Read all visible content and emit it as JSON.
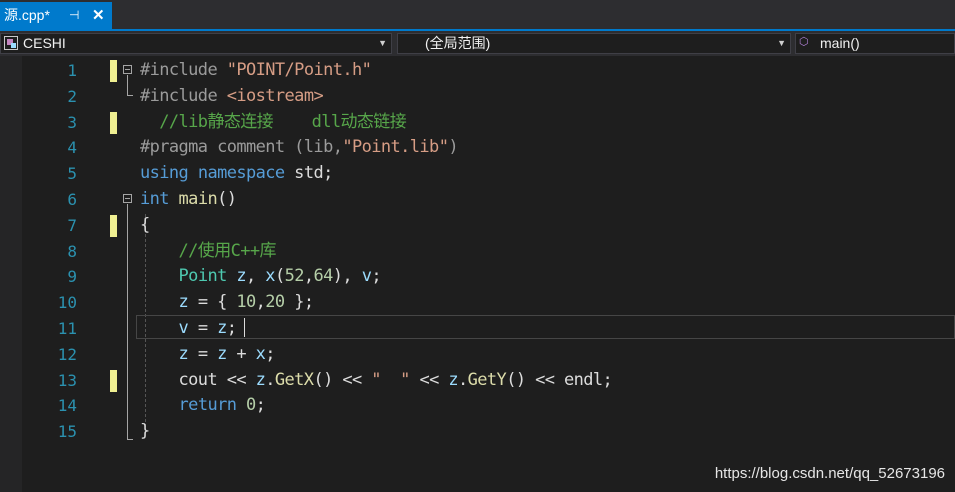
{
  "tab": {
    "label": "源.cpp*",
    "pin_glyph": "⊣",
    "close_glyph": "✕"
  },
  "navbar": {
    "project": "CESHI",
    "scope": "(全局范围)",
    "member": "main()",
    "project_icon": "project-icon",
    "member_icon": "cube-icon"
  },
  "editor": {
    "line_numbers": [
      "1",
      "2",
      "3",
      "4",
      "5",
      "6",
      "7",
      "8",
      "9",
      "10",
      "11",
      "12",
      "13",
      "14",
      "15"
    ],
    "lines": [
      [
        {
          "t": "#include",
          "c": "pp"
        },
        {
          "t": " ",
          "c": "plain"
        },
        {
          "t": "\"POINT/Point.h\"",
          "c": "str"
        }
      ],
      [
        {
          "t": "#include",
          "c": "pp"
        },
        {
          "t": " ",
          "c": "plain"
        },
        {
          "t": "<iostream>",
          "c": "str"
        }
      ],
      [
        {
          "t": "  //lib静态连接    dll动态链接",
          "c": "cm"
        }
      ],
      [
        {
          "t": "#pragma",
          "c": "pp"
        },
        {
          "t": " comment (lib,",
          "c": "pp"
        },
        {
          "t": "\"Point.lib\"",
          "c": "str"
        },
        {
          "t": ")",
          "c": "pp"
        }
      ],
      [
        {
          "t": "using",
          "c": "kw"
        },
        {
          "t": " ",
          "c": "plain"
        },
        {
          "t": "namespace",
          "c": "kw"
        },
        {
          "t": " std;",
          "c": "plain"
        }
      ],
      [
        {
          "t": "int",
          "c": "kw"
        },
        {
          "t": " ",
          "c": "plain"
        },
        {
          "t": "main",
          "c": "fn"
        },
        {
          "t": "()",
          "c": "plain"
        }
      ],
      [
        {
          "t": "{",
          "c": "plain"
        }
      ],
      [
        {
          "t": "    //使用C++库",
          "c": "cm"
        }
      ],
      [
        {
          "t": "    ",
          "c": "plain"
        },
        {
          "t": "Point",
          "c": "typ"
        },
        {
          "t": " ",
          "c": "plain"
        },
        {
          "t": "z",
          "c": "var"
        },
        {
          "t": ", ",
          "c": "plain"
        },
        {
          "t": "x",
          "c": "var"
        },
        {
          "t": "(",
          "c": "plain"
        },
        {
          "t": "52",
          "c": "num"
        },
        {
          "t": ",",
          "c": "plain"
        },
        {
          "t": "64",
          "c": "num"
        },
        {
          "t": "), ",
          "c": "plain"
        },
        {
          "t": "v",
          "c": "var"
        },
        {
          "t": ";",
          "c": "plain"
        }
      ],
      [
        {
          "t": "    ",
          "c": "plain"
        },
        {
          "t": "z",
          "c": "var"
        },
        {
          "t": " = { ",
          "c": "plain"
        },
        {
          "t": "10",
          "c": "num"
        },
        {
          "t": ",",
          "c": "plain"
        },
        {
          "t": "20",
          "c": "num"
        },
        {
          "t": " };",
          "c": "plain"
        }
      ],
      [
        {
          "t": "    ",
          "c": "plain"
        },
        {
          "t": "v",
          "c": "var"
        },
        {
          "t": " = ",
          "c": "plain"
        },
        {
          "t": "z",
          "c": "var"
        },
        {
          "t": ";",
          "c": "plain"
        }
      ],
      [
        {
          "t": "    ",
          "c": "plain"
        },
        {
          "t": "z",
          "c": "var"
        },
        {
          "t": " = ",
          "c": "plain"
        },
        {
          "t": "z",
          "c": "var"
        },
        {
          "t": " + ",
          "c": "plain"
        },
        {
          "t": "x",
          "c": "var"
        },
        {
          "t": ";",
          "c": "plain"
        }
      ],
      [
        {
          "t": "    cout << ",
          "c": "plain"
        },
        {
          "t": "z",
          "c": "var"
        },
        {
          "t": ".",
          "c": "plain"
        },
        {
          "t": "GetX",
          "c": "fn"
        },
        {
          "t": "() << ",
          "c": "plain"
        },
        {
          "t": "\"  \"",
          "c": "str"
        },
        {
          "t": " << ",
          "c": "plain"
        },
        {
          "t": "z",
          "c": "var"
        },
        {
          "t": ".",
          "c": "plain"
        },
        {
          "t": "GetY",
          "c": "fn"
        },
        {
          "t": "() << endl;",
          "c": "plain"
        }
      ],
      [
        {
          "t": "    ",
          "c": "plain"
        },
        {
          "t": "return",
          "c": "kw"
        },
        {
          "t": " ",
          "c": "plain"
        },
        {
          "t": "0",
          "c": "num"
        },
        {
          "t": ";",
          "c": "plain"
        }
      ],
      [
        {
          "t": "}",
          "c": "plain"
        }
      ]
    ],
    "modified_lines": [
      1,
      3,
      7,
      13
    ],
    "current_line": 11
  },
  "watermark": "https://blog.csdn.net/qq_52673196"
}
